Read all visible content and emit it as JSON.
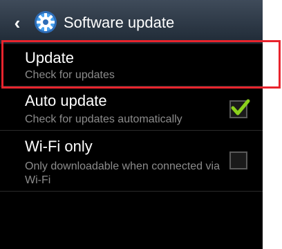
{
  "header": {
    "back_icon": "chevron-left-icon",
    "app_icon": "settings-gear-icon",
    "title": "Software update"
  },
  "items": [
    {
      "title": "Update",
      "subtitle": "Check for updates"
    },
    {
      "title": "Auto update",
      "subtitle": "Check for updates automatically",
      "checked": true
    },
    {
      "title": "Wi-Fi only",
      "subtitle": "Only downloadable when connected via Wi-Fi",
      "checked": false
    }
  ],
  "colors": {
    "action_bar_top": "#3f4b5a",
    "action_bar_bottom": "#1f2a36",
    "background": "#000000",
    "subtitle": "#8c8c8c",
    "check_green": "#8bd11c",
    "highlight_border": "#e8242d"
  }
}
